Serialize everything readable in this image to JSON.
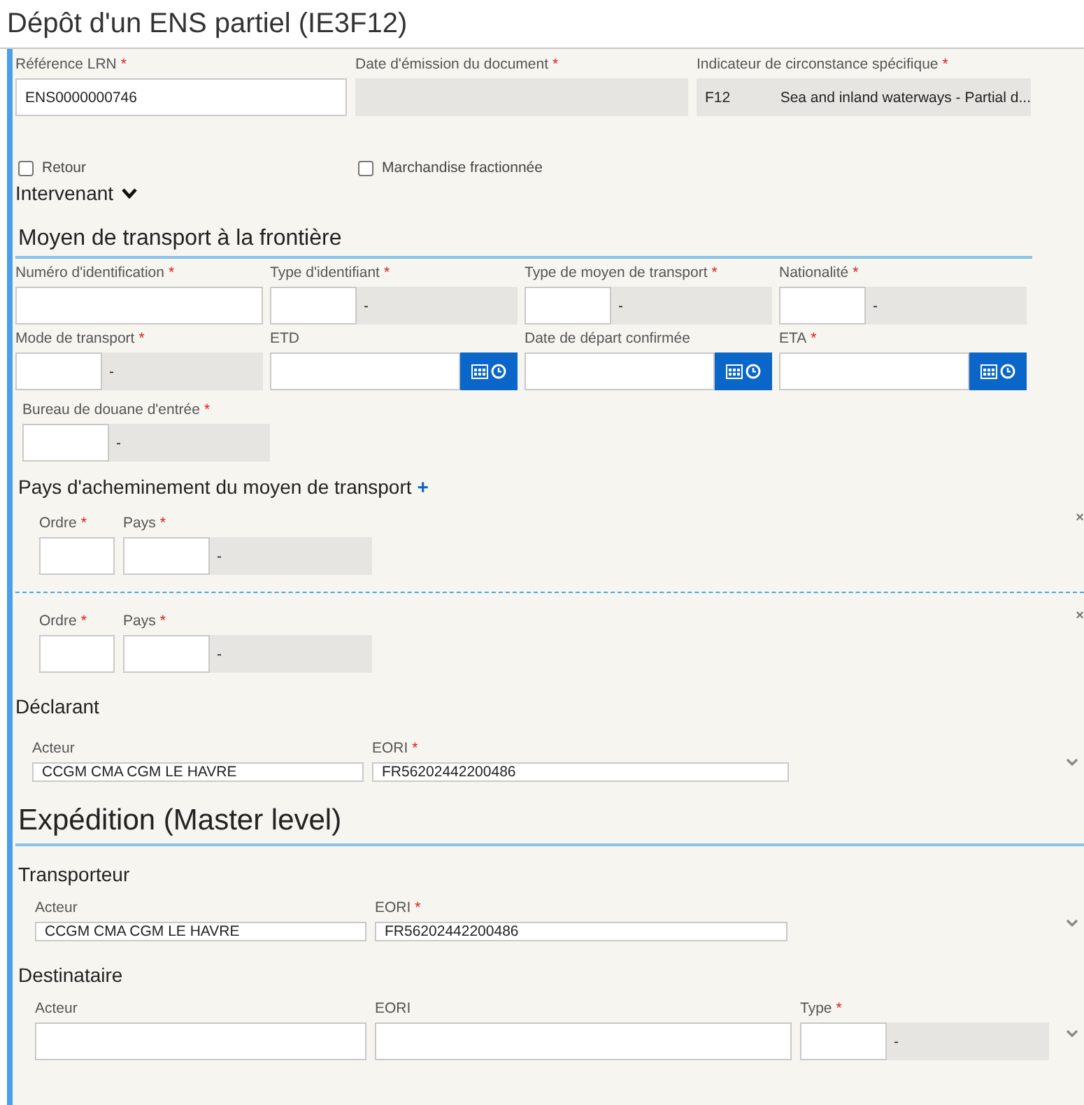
{
  "title": "Dépôt d'un ENS partiel (IE3F12)",
  "required_mark": "*",
  "header_fields": [
    {
      "kind": "text",
      "label": "Référence LRN",
      "required": true,
      "value": "ENS0000000746"
    },
    {
      "kind": "readonly",
      "label": "Date d'émission du document",
      "required": true
    },
    {
      "kind": "select",
      "label": "Indicateur de circonstance spécifique",
      "required": true,
      "code": "F12",
      "description": "Sea and inland waterways - Partial d..."
    }
  ],
  "checkboxes": [
    {
      "label": "Retour",
      "checked": false
    },
    {
      "label": "Marchandise fractionnée",
      "checked": false
    }
  ],
  "intervenant": {
    "label": "Intervenant",
    "expanded": false
  },
  "transport": {
    "title": "Moyen de transport à la frontière",
    "fields": [
      {
        "kind": "text",
        "label": "Numéro d'identification",
        "required": true
      },
      {
        "kind": "code",
        "label": "Type d'identifiant",
        "required": true,
        "description": "-"
      },
      {
        "kind": "code",
        "label": "Type de moyen de transport",
        "required": true,
        "description": "-"
      },
      {
        "kind": "code",
        "label": "Nationalité",
        "required": true,
        "description": "-"
      },
      {
        "kind": "code",
        "label": "Mode de transport",
        "required": true,
        "description": "-"
      },
      {
        "kind": "date",
        "label": "ETD",
        "required": false
      },
      {
        "kind": "date",
        "label": "Date de départ confirmée",
        "required": false
      },
      {
        "kind": "date",
        "label": "ETA",
        "required": true
      }
    ],
    "office": {
      "kind": "code",
      "label": "Bureau de douane d'entrée",
      "required": true,
      "description": "-"
    },
    "route": {
      "title": "Pays d'acheminement du moyen de transport",
      "add_symbol": "+",
      "remove_symbol": "×",
      "rows": [
        {
          "fields": [
            {
              "kind": "text",
              "label": "Ordre",
              "required": true
            },
            {
              "kind": "code",
              "label": "Pays",
              "required": true,
              "description": "-"
            }
          ]
        },
        {
          "fields": [
            {
              "kind": "text",
              "label": "Ordre",
              "required": true
            },
            {
              "kind": "code",
              "label": "Pays",
              "required": true,
              "description": "-"
            }
          ]
        }
      ]
    }
  },
  "declarant": {
    "title": "Déclarant",
    "fields": [
      {
        "kind": "text",
        "label": "Acteur",
        "required": false,
        "value": "CCGM CMA CGM LE HAVRE"
      },
      {
        "kind": "text",
        "label": "EORI",
        "required": true,
        "value": "FR56202442200486"
      }
    ]
  },
  "expedition": {
    "title": "Expédition (Master level)",
    "parties": [
      {
        "title": "Transporteur",
        "fields": [
          {
            "kind": "text",
            "label": "Acteur",
            "required": false,
            "value": "CCGM CMA CGM LE HAVRE"
          },
          {
            "kind": "text",
            "label": "EORI",
            "required": true,
            "value": "FR56202442200486"
          }
        ]
      },
      {
        "title": "Destinataire",
        "fields": [
          {
            "kind": "text",
            "label": "Acteur",
            "required": false
          },
          {
            "kind": "text",
            "label": "EORI",
            "required": false
          },
          {
            "kind": "code",
            "label": "Type",
            "required": true,
            "description": "-"
          }
        ]
      }
    ]
  }
}
